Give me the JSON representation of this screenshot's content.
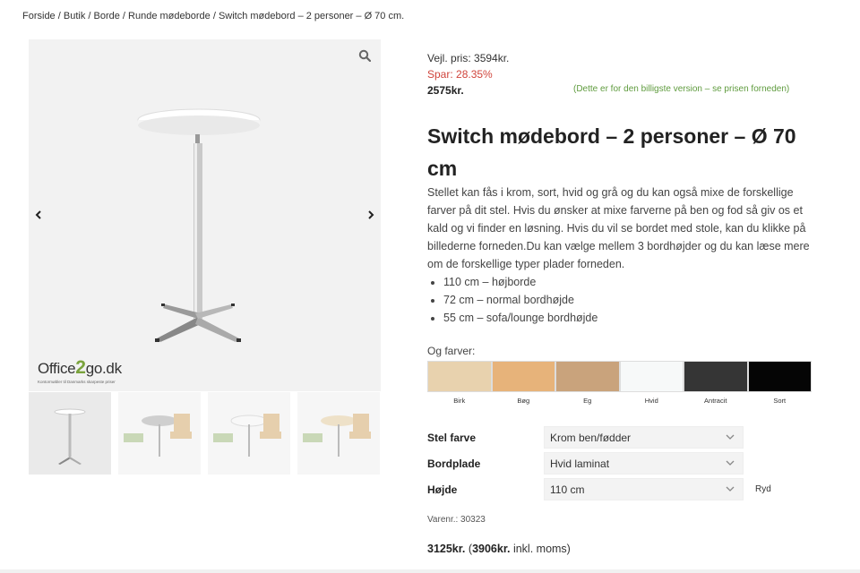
{
  "breadcrumb": {
    "items": [
      "Forside",
      "Butik",
      "Borde",
      "Runde mødeborde",
      "Switch mødebord – 2 personer – Ø 70 cm."
    ],
    "separator": " / "
  },
  "gallery": {
    "logo_text_a": "Office",
    "logo_text_b": "2",
    "logo_text_c": "go.dk",
    "logo_sub": "Kontormøbler til Danmarks skarpeste priser",
    "zoom_icon": "search-icon",
    "prev_icon": "chevron-left-icon",
    "next_icon": "chevron-right-icon"
  },
  "price": {
    "reg_label": "Vejl. pris: 3594kr.",
    "save_label": "Spar: 28.35%",
    "now_label": "2575kr.",
    "note": "(Dette er for den billigste version – se prisen forneden)"
  },
  "product": {
    "title": "Switch mødebord – 2 personer – Ø 70 cm",
    "description": "Stellet kan fås i krom, sort, hvid og grå og du kan også mixe de forskellige farver på dit stel.  Hvis du ønsker at mixe farverne på ben og fod så giv os et kald og vi finder en løsning. Hvis du vil se bordet med stole, kan du klikke på billederne forneden.Du kan vælge mellem 3 bordhøjder og du kan læse mere om de forskellige typer plader forneden.",
    "heights": [
      "110 cm – højborde",
      "72 cm – normal bordhøjde",
      "55 cm – sofa/lounge bordhøjde"
    ]
  },
  "colors": {
    "label": "Og farver:",
    "swatches": [
      {
        "name": "Birk",
        "color": "#e8d2ae"
      },
      {
        "name": "Bøg",
        "color": "#e7b37a"
      },
      {
        "name": "Eg",
        "color": "#c9a37c"
      },
      {
        "name": "Hvid",
        "color": "#f7f9f9"
      },
      {
        "name": "Antracit",
        "color": "#353535"
      },
      {
        "name": "Sort",
        "color": "#050505"
      }
    ]
  },
  "options": {
    "stel_label": "Stel farve",
    "stel_value": "Krom ben/fødder",
    "plade_label": "Bordplade",
    "plade_value": "Hvid laminat",
    "hojde_label": "Højde",
    "hojde_value": "110 cm",
    "reset_label": "Ryd"
  },
  "sku": {
    "label": "Varenr.: 30323"
  },
  "total": {
    "price": "3125kr.",
    "open": " (",
    "incl_price": "3906kr.",
    "incl_text": " inkl. moms)"
  },
  "theme": {
    "sale_red": "#d0453c",
    "note_green": "#5f9b3e",
    "logo_green": "#7aa33c"
  }
}
